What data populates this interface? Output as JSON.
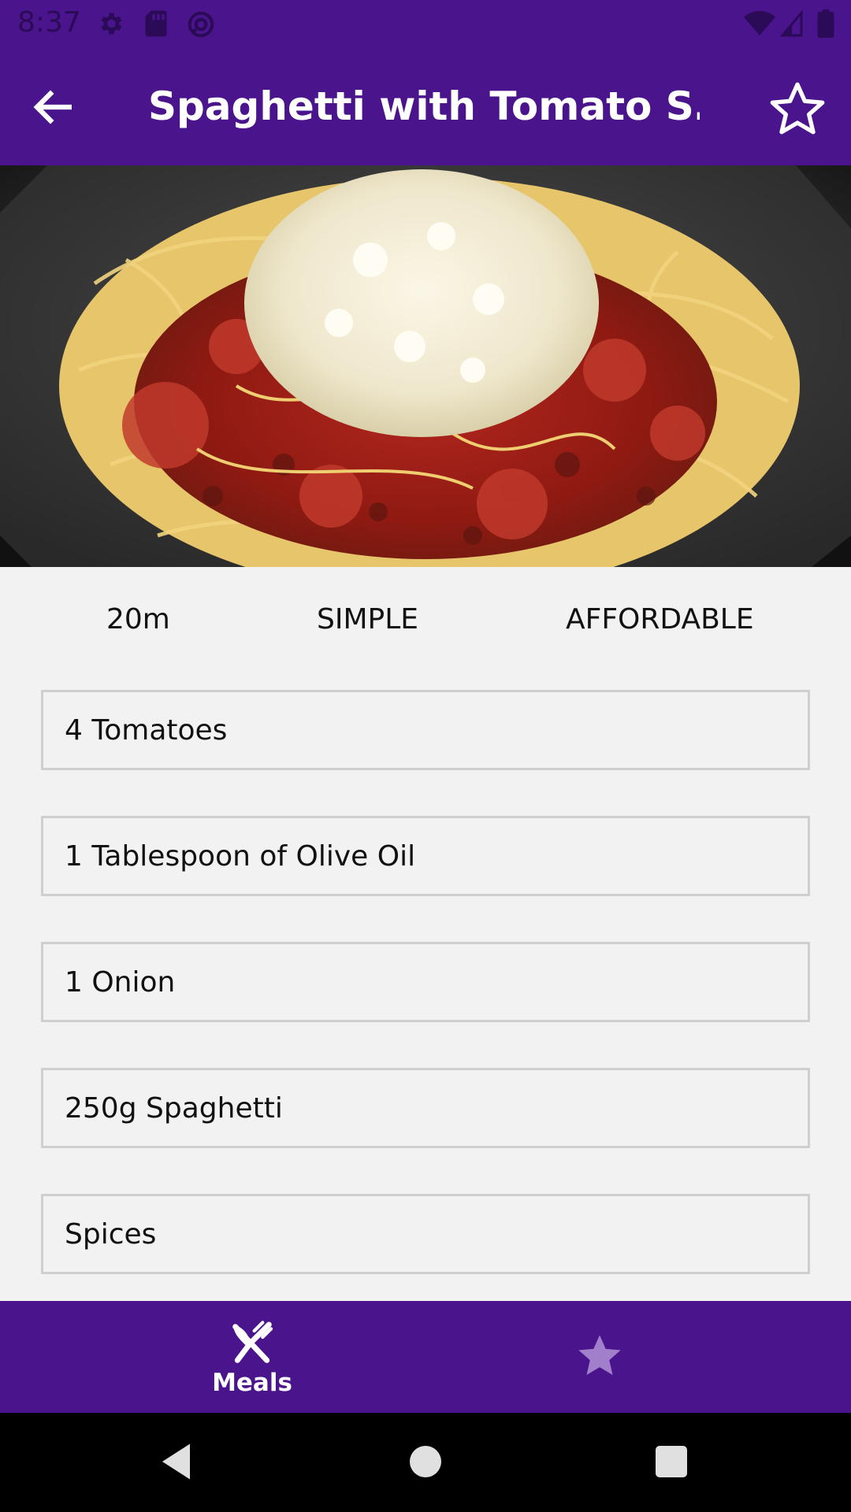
{
  "status_bar": {
    "time": "8:37"
  },
  "app_bar": {
    "title": "Spaghetti with Tomato S…"
  },
  "recipe": {
    "image_description_icon": "spaghetti-dish-photo",
    "duration": "20m",
    "complexity": "SIMPLE",
    "affordability": "AFFORDABLE",
    "ingredients": [
      "4 Tomatoes",
      "1 Tablespoon of Olive Oil",
      "1 Onion",
      "250g Spaghetti",
      "Spices"
    ]
  },
  "bottom_nav": {
    "meals_label": "Meals"
  },
  "colors": {
    "primary": "#4a148c",
    "background": "#f2f2f2",
    "inactive_icon": "#a27fcb"
  }
}
